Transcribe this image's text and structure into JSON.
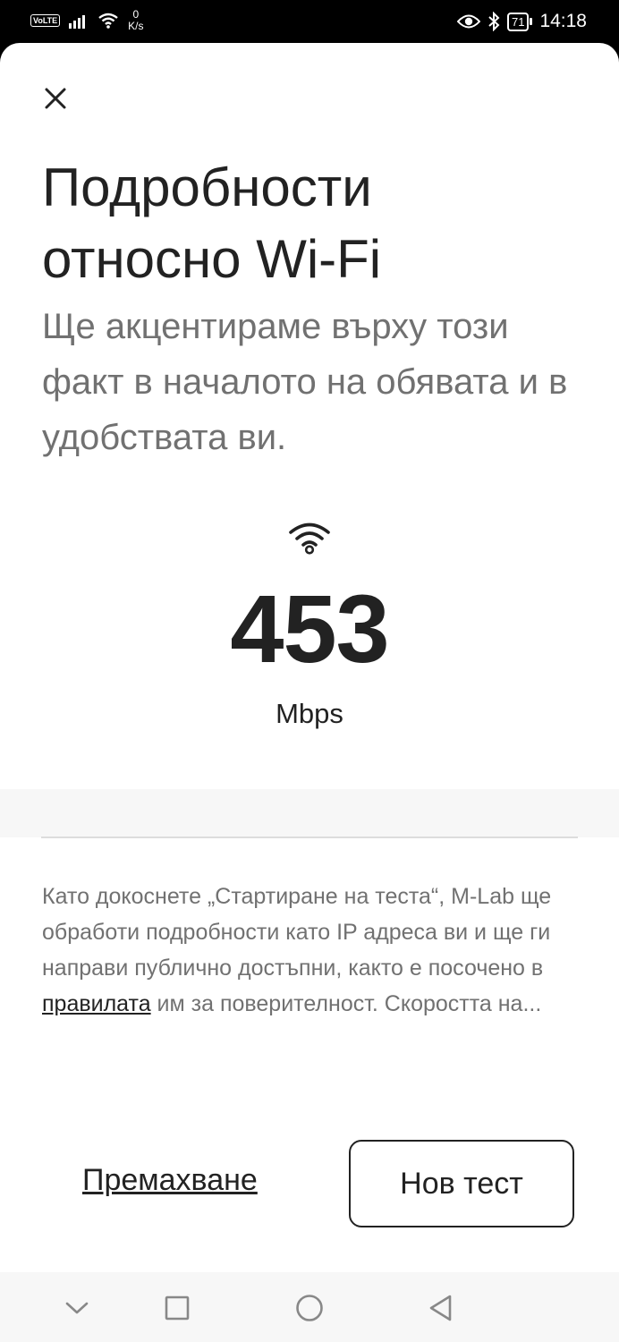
{
  "status_bar": {
    "volte": "VoLTE",
    "net_speed_value": "0",
    "net_speed_unit": "K/s",
    "battery": "71",
    "time": "14:18"
  },
  "modal": {
    "title": "Подробности относно Wi-Fi",
    "subtitle": "Ще акцентираме върху този факт в началото на обявата и в удобствата ви.",
    "speed_value": "453",
    "speed_unit": "Mbps",
    "disclaimer_before_link": "Като докоснете „Стартиране на теста“, M-Lab ще обработи подробности като IP адреса ви и ще ги направи публично достъпни, както е посочено в ",
    "disclaimer_link": "правилата",
    "disclaimer_after_link": " им за поверителност. Скоростта на...",
    "remove_label": "Премахване",
    "new_test_label": "Нов тест"
  },
  "icons": {
    "close": "close-icon",
    "wifi": "wifi-icon",
    "nav_back": "triangle-back-icon",
    "nav_home": "circle-home-icon",
    "nav_recents": "square-recents-icon",
    "nav_down": "chevron-down-icon"
  },
  "colors": {
    "text_primary": "#222222",
    "text_secondary": "#717171",
    "divider": "#dddddd",
    "band": "#f7f7f7"
  }
}
